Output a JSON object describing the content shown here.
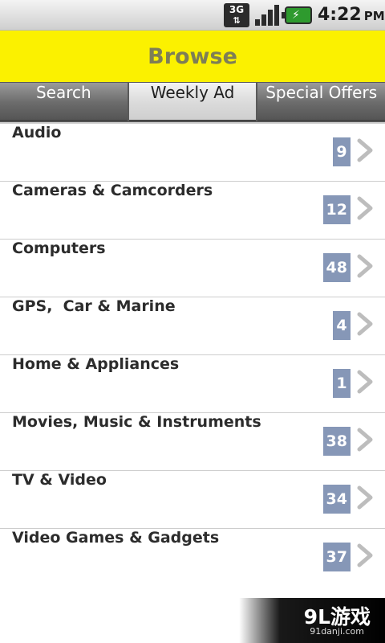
{
  "status_bar": {
    "network": "3G",
    "network_arrows": "⇅",
    "time": "4:22",
    "ampm": "PM",
    "icons": [
      "network-3g-icon",
      "signal-strength-icon",
      "battery-charging-icon"
    ]
  },
  "header": {
    "title": "Browse"
  },
  "tabs": [
    {
      "label": "Search",
      "active": false
    },
    {
      "label": "Weekly Ad",
      "active": true
    },
    {
      "label": "Special Offers",
      "active": false
    }
  ],
  "categories": [
    {
      "label": "Audio",
      "count": "9"
    },
    {
      "label": "Cameras & Camcorders",
      "count": "12"
    },
    {
      "label": "Computers",
      "count": "48"
    },
    {
      "label": "GPS,  Car & Marine",
      "count": "4"
    },
    {
      "label": "Home & Appliances",
      "count": "1"
    },
    {
      "label": "Movies, Music & Instruments",
      "count": "38"
    },
    {
      "label": "TV & Video",
      "count": "34"
    },
    {
      "label": "Video Games & Gadgets",
      "count": "37"
    }
  ],
  "watermark": {
    "logo": "9L游戏",
    "site": "91danji.com"
  },
  "colors": {
    "header_bg": "#fbf100",
    "header_text": "#7e7e56",
    "badge_bg": "#8697b7",
    "tab_active_bg": "#dadada",
    "tab_inactive_bg": "#6b6b6b"
  }
}
